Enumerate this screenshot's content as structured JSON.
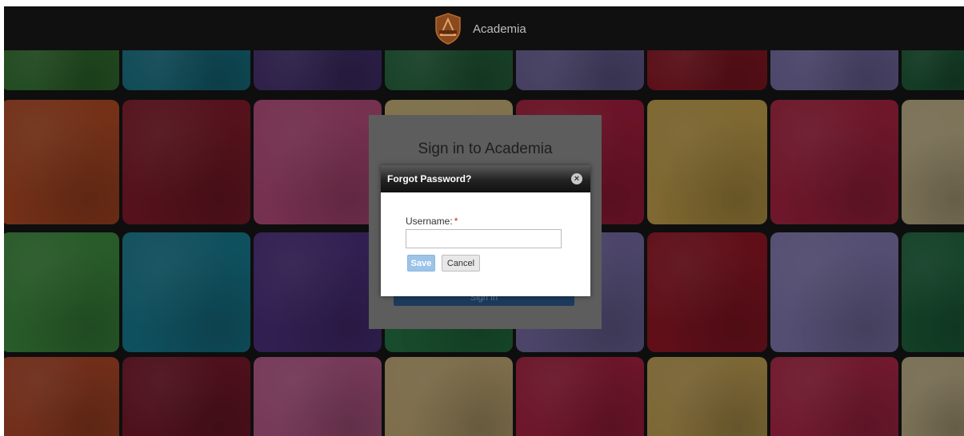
{
  "header": {
    "logo_icon": "academia-shield-logo-icon",
    "app_title": "Academia"
  },
  "background": {
    "description_colors": [
      "#3f8f40",
      "#1f8fa3",
      "#5a3d8c",
      "#2e7f4d",
      "#7a6fb0",
      "#a41c2c",
      "#8a7fc1",
      "#1f6b45"
    ]
  },
  "signin": {
    "title": "Sign in to Academia",
    "button_label": "Sign In"
  },
  "dialog": {
    "title": "Forgot Password?",
    "close_icon": "close-circle-icon",
    "username_label": "Username:",
    "required_marker": "*",
    "username_value": "",
    "username_placeholder": "",
    "save_label": "Save",
    "cancel_label": "Cancel"
  }
}
